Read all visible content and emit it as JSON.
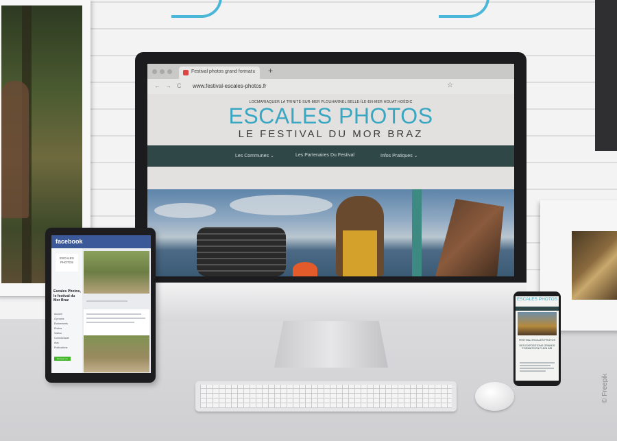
{
  "browser": {
    "tab_title": "Festival photos grand format :",
    "tab_close": "×",
    "new_tab": "+",
    "nav_back": "←",
    "nav_forward": "→",
    "nav_reload": "C",
    "url": "www.festival-escales-photos.fr",
    "bookmark": "☆"
  },
  "site": {
    "towns": "LOCMARIAQUER  LA TRINITÉ-SUR-MER  PLOUHARNEL  BELLE-ÎLE-EN-MER  HOUAT  HOËDIC",
    "brand": "ESCALES PHOTOS",
    "tagline": "LE FESTIVAL DU MOR BRAZ",
    "nav": [
      {
        "label": "Les Communes  ⌄"
      },
      {
        "label": "Les Partenaires Du Festival"
      },
      {
        "label": "Infos Pratiques  ⌄"
      }
    ]
  },
  "tablet": {
    "app": "facebook",
    "page_logo": "ESCALES PHOTOS",
    "page_name": "Escales Photos, le festival du Mor Braz",
    "menu": [
      "Accueil",
      "À propos",
      "Événements",
      "Photos",
      "Vidéos",
      "Communauté",
      "Avis",
      "Publications"
    ],
    "cta": "Envoyer un message"
  },
  "phone": {
    "brand": "ESCALES PHOTOS",
    "headline": "FESTIVAL ESCALES PHOTOS",
    "sub": "DES EXPOSITIONS GRANDS FORMATS EN PLEIN AIR"
  },
  "credit": "© Freepik"
}
